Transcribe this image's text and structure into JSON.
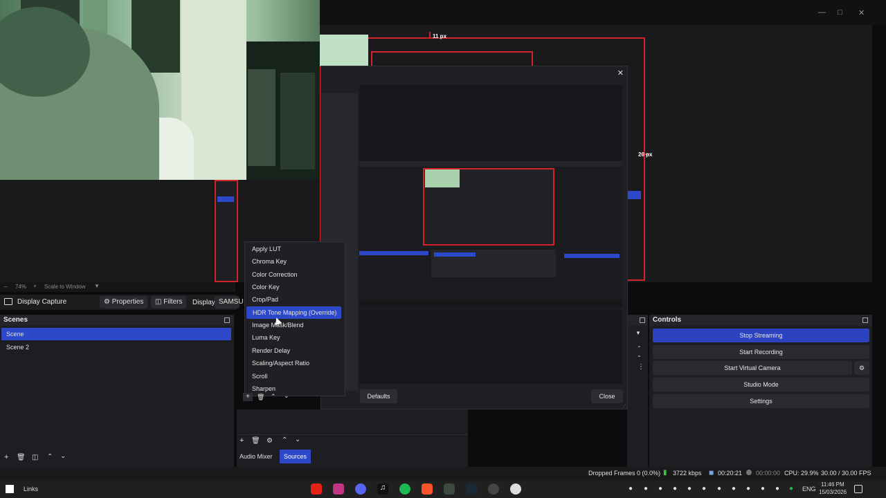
{
  "preview": {
    "px_top_label": "11 px",
    "px_right_label": "20 px"
  },
  "zoom": {
    "percent": "74%",
    "scale_mode": "Scale to Window"
  },
  "source_toolbar": {
    "source_name": "Display Capture",
    "properties_label": "Properties",
    "filters_label": "Filters",
    "display_label": "Display",
    "display_value": "SAMSU"
  },
  "scenes": {
    "title": "Scenes",
    "items": [
      "Scene",
      "Scene 2"
    ],
    "selected": "Scene"
  },
  "bottom_tabs": {
    "audio_mixer": "Audio Mixer",
    "sources": "Sources",
    "active": "Sources"
  },
  "controls": {
    "title": "Controls",
    "stop_streaming": "Stop Streaming",
    "start_recording": "Start Recording",
    "start_virtual_camera": "Start Virtual Camera",
    "studio_mode": "Studio Mode",
    "settings": "Settings"
  },
  "dialog": {
    "defaults_label": "Defaults",
    "close_label": "Close"
  },
  "context_menu": {
    "items": [
      "Apply LUT",
      "Chroma Key",
      "Color Correction",
      "Color Key",
      "Crop/Pad",
      "HDR Tone Mapping (Override)",
      "Image Mask/Blend",
      "Luma Key",
      "Render Delay",
      "Scaling/Aspect Ratio",
      "Scroll",
      "Sharpen"
    ],
    "highlighted": "HDR Tone Mapping (Override)"
  },
  "status": {
    "dropped_frames": "Dropped Frames 0 (0.0%)",
    "bitrate": "3722 kbps",
    "stream_time": "00:20:21",
    "rec_time": "00:00:00",
    "cpu": "CPU: 29.9%",
    "fps": "30.00 / 30.00 FPS"
  },
  "taskbar": {
    "search_label": "Links",
    "language": "ENG",
    "time": "11:46 PM",
    "date": "15/03/2026"
  },
  "colors": {
    "accent": "#2d48c9",
    "record_red": "#d3232a",
    "bitrate_green": "#3cc73c"
  }
}
